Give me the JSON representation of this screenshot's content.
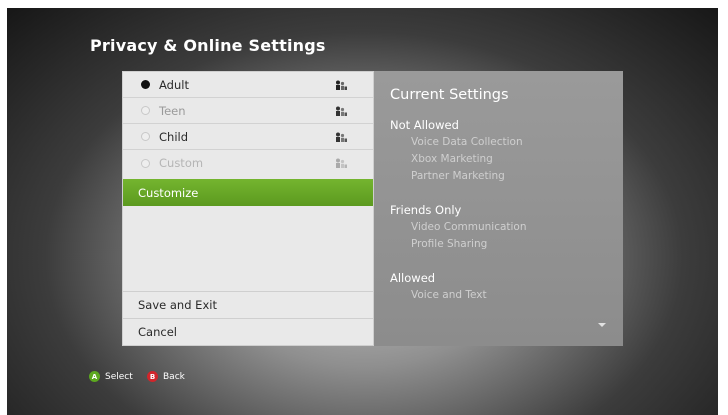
{
  "page": {
    "title": "Privacy & Online Settings"
  },
  "options": [
    {
      "label": "Adult",
      "selected": true
    },
    {
      "label": "Teen",
      "selected": false
    },
    {
      "label": "Child",
      "selected": false
    },
    {
      "label": "Custom",
      "selected": false
    }
  ],
  "menu": {
    "customize_label": "Customize",
    "save_label": "Save and Exit",
    "cancel_label": "Cancel"
  },
  "current_settings": {
    "title": "Current Settings",
    "not_allowed": {
      "heading": "Not Allowed",
      "items": [
        "Voice Data Collection",
        "Xbox Marketing",
        "Partner Marketing"
      ]
    },
    "friends_only": {
      "heading": "Friends Only",
      "items": [
        "Video Communication",
        "Profile Sharing"
      ]
    },
    "allowed": {
      "heading": "Allowed",
      "items": [
        "Voice and Text"
      ]
    }
  },
  "footer": {
    "select": {
      "button": "A",
      "label": "Select",
      "color": "#5ca81f"
    },
    "back": {
      "button": "B",
      "label": "Back",
      "color": "#d1252b"
    }
  },
  "colors": {
    "accent": "#6aad27",
    "panel_left": "#e9e9e9",
    "panel_right": "#939393"
  },
  "icons": {
    "rating_icon": "people-icon",
    "scroll": "chevron-down-icon"
  }
}
